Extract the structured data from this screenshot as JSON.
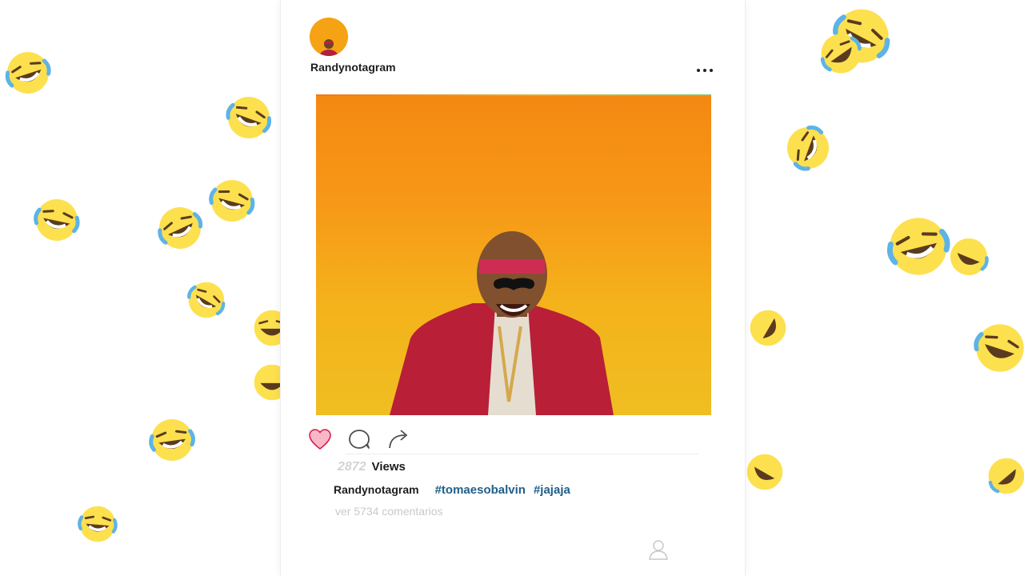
{
  "post": {
    "username_header": "Randynotagram",
    "more_icon": "more-dots-icon",
    "photo_subject": "man-in-red-jacket-laughing",
    "actions": {
      "like_icon": "heart-icon",
      "comment_icon": "comment-icon",
      "share_icon": "share-arrow-icon"
    },
    "views": {
      "count": "2872",
      "label": "Views"
    },
    "caption": {
      "username": "Randynotagram",
      "hashtags": [
        "#tomaesobalvin",
        "#jajaja"
      ]
    },
    "comments_link": "ver 5734 comentarios",
    "bottom_icon": "profile-icon"
  },
  "background": {
    "emoji_name": "face-with-tears-of-joy-emoji",
    "color": "#fde04e"
  },
  "colors": {
    "like_fill": "#f8b8c8",
    "like_stroke": "#d81b48",
    "hashtag": "#1e5f8a",
    "photo_top": "#f48812",
    "photo_bottom": "#efbe22"
  }
}
